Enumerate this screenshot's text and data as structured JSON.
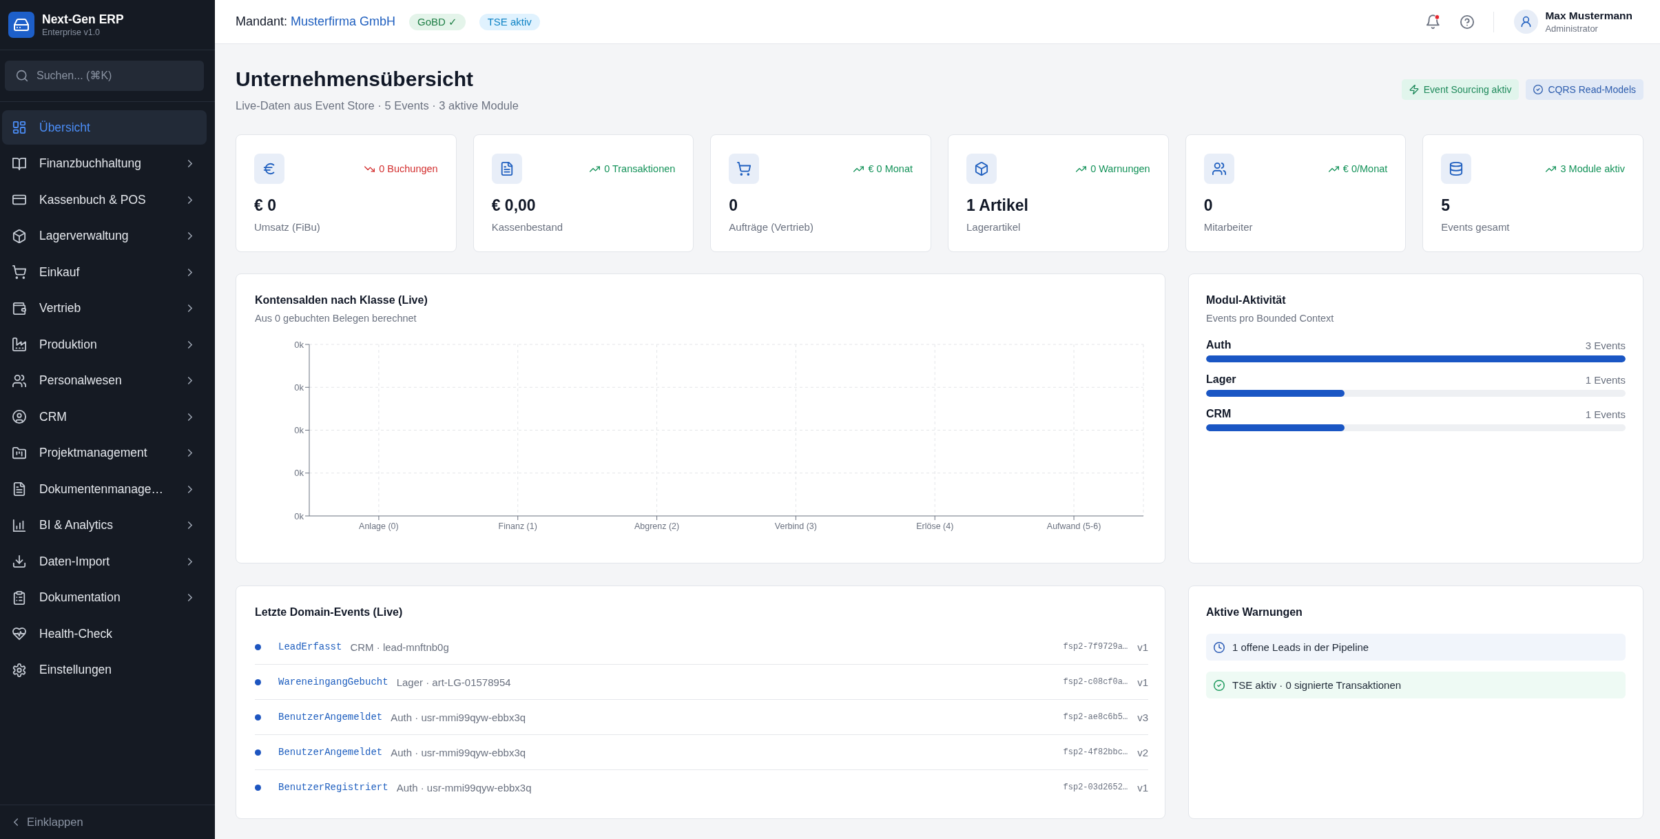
{
  "sidebar": {
    "brand": {
      "name": "Next-Gen ERP",
      "edition": "Enterprise v1.0"
    },
    "search": {
      "placeholder": "Suchen... (⌘K)"
    },
    "items": [
      {
        "label": "Übersicht",
        "selected": true,
        "expandable": false
      },
      {
        "label": "Finanzbuchhaltung",
        "selected": false,
        "expandable": true
      },
      {
        "label": "Kassenbuch & POS",
        "selected": false,
        "expandable": true
      },
      {
        "label": "Lagerverwaltung",
        "selected": false,
        "expandable": true
      },
      {
        "label": "Einkauf",
        "selected": false,
        "expandable": true
      },
      {
        "label": "Vertrieb",
        "selected": false,
        "expandable": true
      },
      {
        "label": "Produktion",
        "selected": false,
        "expandable": true
      },
      {
        "label": "Personalwesen",
        "selected": false,
        "expandable": true
      },
      {
        "label": "CRM",
        "selected": false,
        "expandable": true
      },
      {
        "label": "Projektmanagement",
        "selected": false,
        "expandable": true
      },
      {
        "label": "Dokumentenmanage…",
        "selected": false,
        "expandable": true
      },
      {
        "label": "BI & Analytics",
        "selected": false,
        "expandable": true
      },
      {
        "label": "Daten-Import",
        "selected": false,
        "expandable": true
      },
      {
        "label": "Dokumentation",
        "selected": false,
        "expandable": true
      },
      {
        "label": "Health-Check",
        "selected": false,
        "expandable": false
      },
      {
        "label": "Einstellungen",
        "selected": false,
        "expandable": false
      }
    ],
    "collapse": {
      "label": "Einklappen"
    }
  },
  "header": {
    "tenant_label": "Mandant:",
    "tenant": "Musterfirma GmbH",
    "badges": [
      {
        "label": "GoBD ✓",
        "kind": "success"
      },
      {
        "label": "TSE aktiv",
        "kind": "info"
      }
    ],
    "notifications": {
      "unread": true
    },
    "user": {
      "name": "Max Mustermann",
      "role": "Administrator"
    }
  },
  "page": {
    "title": "Unternehmensübersicht",
    "subtitle": "Live-Daten aus Event Store · 5 Events · 3 aktive Module",
    "badges": [
      {
        "label": "Event Sourcing aktiv",
        "kind": "success"
      },
      {
        "label": "CQRS Read-Models",
        "kind": "info"
      }
    ]
  },
  "stats": [
    {
      "value": "€ 0",
      "label": "Umsatz (FiBu)",
      "negative": true,
      "trend_text": "0 Buchungen"
    },
    {
      "value": "€ 0,00",
      "label": "Kassenbestand",
      "negative": false,
      "trend_text": "0 Transaktionen"
    },
    {
      "value": "0",
      "label": "Aufträge (Vertrieb)",
      "negative": false,
      "trend_text": "€ 0 Monat"
    },
    {
      "value": "1 Artikel",
      "label": "Lagerartikel",
      "negative": false,
      "trend_text": "0 Warnungen"
    },
    {
      "value": "0",
      "label": "Mitarbeiter",
      "negative": false,
      "trend_text": "€ 0/Monat"
    },
    {
      "value": "5",
      "label": "Events gesamt",
      "negative": false,
      "trend_text": "3 Module aktiv"
    }
  ],
  "balances": {
    "subtitle": "Aus 0 gebuchten Belegen berechnet",
    "chart_data": {
      "type": "bar",
      "title": "Kontensalden nach Klasse (Live)",
      "categories": [
        "Anlage (0)",
        "Finanz (1)",
        "Abgrenz (2)",
        "Verbind (3)",
        "Erlöse (4)",
        "Aufwand (5-6)"
      ],
      "values": [
        0,
        0,
        0,
        0,
        0,
        0
      ],
      "ylim": [
        0,
        4
      ],
      "yticks": [
        {
          "value": 0,
          "label": "0k"
        },
        {
          "value": 1,
          "label": "0k"
        },
        {
          "value": 2,
          "label": "0k"
        },
        {
          "value": 3,
          "label": "0k"
        },
        {
          "value": 4,
          "label": "0k"
        }
      ],
      "grid": true
    }
  },
  "module_activity": {
    "title": "Modul-Aktivität",
    "subtitle": "Events pro Bounded Context",
    "modules": [
      {
        "name": "Auth",
        "count": "3 Events",
        "level": 1
      },
      {
        "name": "Lager",
        "count": "1 Events",
        "level": 0.33
      },
      {
        "name": "CRM",
        "count": "1 Events",
        "level": 0.33
      }
    ]
  },
  "domain_events": {
    "title": "Letzte Domain-Events (Live)",
    "events": [
      {
        "name": "LeadErfasst",
        "meta": "CRM · lead-mnftnb0g",
        "hash": "fsp2-7f9729a…",
        "version": "v1"
      },
      {
        "name": "WareneingangGebucht",
        "meta": "Lager · art-LG-01578954",
        "hash": "fsp2-c08cf0a…",
        "version": "v1"
      },
      {
        "name": "BenutzerAngemeldet",
        "meta": "Auth · usr-mmi99qyw-ebbx3q",
        "hash": "fsp2-ae8c6b5…",
        "version": "v3"
      },
      {
        "name": "BenutzerAngemeldet",
        "meta": "Auth · usr-mmi99qyw-ebbx3q",
        "hash": "fsp2-4f82bbc…",
        "version": "v2"
      },
      {
        "name": "BenutzerRegistriert",
        "meta": "Auth · usr-mmi99qyw-ebbx3q",
        "hash": "fsp2-03d2652…",
        "version": "v1"
      }
    ]
  },
  "warnings": {
    "title": "Aktive Warnungen",
    "items": [
      {
        "text": "1 offene Leads in der Pipeline",
        "kind": "info"
      },
      {
        "text": "TSE aktiv · 0 signierte Transaktionen",
        "kind": "success"
      }
    ]
  }
}
